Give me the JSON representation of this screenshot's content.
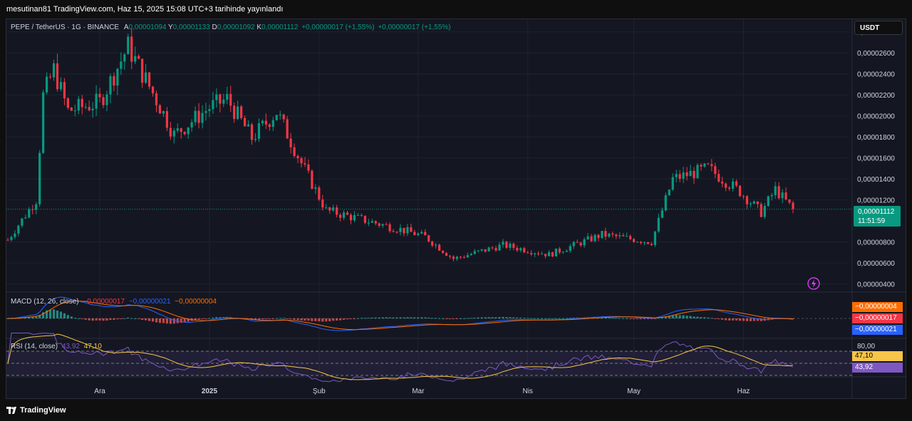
{
  "header": {
    "publish_line": "mesutinan81 TradingView.com, Haz 15, 2025 15:08 UTC+3 tarihinde yayınlandı"
  },
  "symbol": {
    "name": "PEPE / TetherUS · 1G · BINANCE",
    "o_label": "A",
    "o": "0,00001094",
    "h_label": "Y",
    "h": "0,00001133",
    "l_label": "D",
    "l": "0,00001092",
    "c_label": "K",
    "c": "0,00001112",
    "change": "+0,00000017 (+1,55%)",
    "change2": "+0,00000017 (+1,55%)"
  },
  "currency_button": "USDT",
  "last_price": {
    "value": "0,00001112",
    "countdown": "11:51:59"
  },
  "price_axis": {
    "labels": [
      "0,00002800",
      "0,00002600",
      "0,00002400",
      "0,00002200",
      "0,00002000",
      "0,00001800",
      "0,00001600",
      "0,00001400",
      "0,00001200",
      "0,00000800",
      "0,00000600",
      "0,00000400"
    ]
  },
  "macd": {
    "label": "MACD (12, 26, close)",
    "hist": "−0,00000017",
    "macd": "−0,00000021",
    "signal": "−0,00000004",
    "badges": [
      "−0,00000004",
      "−0,00000017",
      "−0,00000021"
    ]
  },
  "rsi": {
    "label": "RSI (14, close)",
    "value": "43,92",
    "ma": "47,10",
    "level_label": "80,00",
    "badges": [
      "47,10",
      "43,92"
    ]
  },
  "time_axis": {
    "labels": [
      "Ara",
      "2025",
      "Şub",
      "Mar",
      "Nis",
      "May",
      "Haz"
    ]
  },
  "footer": {
    "brand": "TradingView"
  },
  "colors": {
    "up": "#089981",
    "down": "#f23645",
    "macd": "#2962ff",
    "signal": "#ff6d00",
    "rsi": "#7e57c2",
    "rsi_ma": "#f7c548",
    "grid": "#1f2230"
  },
  "chart_data": {
    "type": "candlestick",
    "price_axis_range": [
      3.3e-06,
      2.92e-05
    ],
    "closes_key_points": [
      {
        "date": "2024-11-05",
        "close": 8.2e-06
      },
      {
        "date": "2024-11-13",
        "close": 1.2e-05
      },
      {
        "date": "2024-11-15",
        "close": 2.19e-05
      },
      {
        "date": "2024-11-18",
        "close": 2.44e-05
      },
      {
        "date": "2024-11-22",
        "close": 2.05e-05
      },
      {
        "date": "2024-12-01",
        "close": 2.13e-05
      },
      {
        "date": "2024-12-09",
        "close": 2.66e-05
      },
      {
        "date": "2024-12-18",
        "close": 2.09e-05
      },
      {
        "date": "2024-12-22",
        "close": 1.82e-05
      },
      {
        "date": "2025-01-01",
        "close": 2.08e-05
      },
      {
        "date": "2025-01-06",
        "close": 2.16e-05
      },
      {
        "date": "2025-01-13",
        "close": 1.79e-05
      },
      {
        "date": "2025-01-20",
        "close": 2.04e-05
      },
      {
        "date": "2025-01-27",
        "close": 1.55e-05
      },
      {
        "date": "2025-02-03",
        "close": 1.1e-05
      },
      {
        "date": "2025-02-10",
        "close": 1.04e-05
      },
      {
        "date": "2025-02-24",
        "close": 9.2e-06
      },
      {
        "date": "2025-03-03",
        "close": 8.5e-06
      },
      {
        "date": "2025-03-11",
        "close": 6.4e-06
      },
      {
        "date": "2025-03-25",
        "close": 7.7e-06
      },
      {
        "date": "2025-04-07",
        "close": 6.8e-06
      },
      {
        "date": "2025-04-22",
        "close": 8.7e-06
      },
      {
        "date": "2025-05-06",
        "close": 8e-06
      },
      {
        "date": "2025-05-12",
        "close": 1.4e-05
      },
      {
        "date": "2025-05-22",
        "close": 1.5e-05
      },
      {
        "date": "2025-05-31",
        "close": 1.28e-05
      },
      {
        "date": "2025-06-06",
        "close": 1.08e-05
      },
      {
        "date": "2025-06-10",
        "close": 1.3e-05
      },
      {
        "date": "2025-06-15",
        "close": 1.11e-05
      }
    ],
    "last_close": 1.112e-05,
    "rsi_levels": [
      70,
      50,
      30
    ],
    "rsi_last": 43.92,
    "rsi_ma_last": 47.1
  }
}
